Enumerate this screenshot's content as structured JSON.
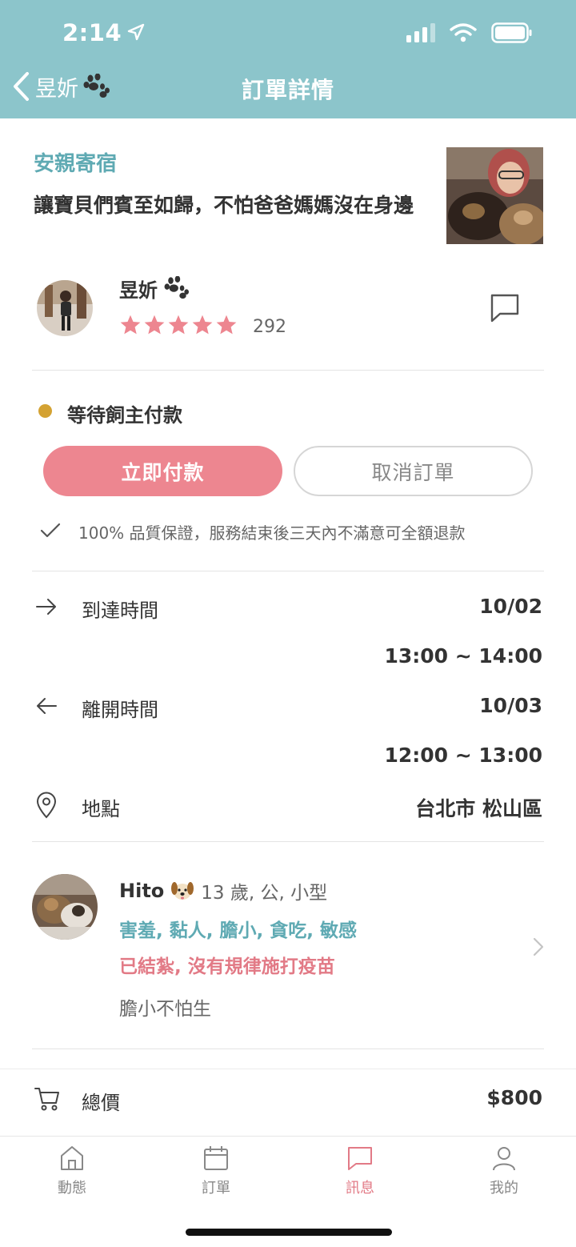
{
  "status_bar": {
    "time": "2:14"
  },
  "nav": {
    "back_label": "昱妡",
    "title": "訂單詳情"
  },
  "service": {
    "category": "安親寄宿",
    "headline": "讓寶貝們賓至如歸，不怕爸爸媽媽沒在身邊"
  },
  "sitter": {
    "name": "昱妡",
    "rating_stars": 5,
    "review_count": "292"
  },
  "order": {
    "status": "等待飼主付款",
    "status_color": "#d4a232",
    "pay_button": "立即付款",
    "cancel_button": "取消訂單",
    "guarantee": "100% 品質保證，服務結束後三天內不滿意可全額退款"
  },
  "schedule": {
    "arrival_label": "到達時間",
    "arrival_date": "10/02",
    "arrival_time": "13:00 ~ 14:00",
    "departure_label": "離開時間",
    "departure_date": "10/03",
    "departure_time": "12:00 ~ 13:00",
    "location_label": "地點",
    "location_value": "台北市 松山區"
  },
  "pet": {
    "name": "Hito",
    "details": "13 歲, 公, 小型",
    "traits": "害羞, 黏人, 膽小, 貪吃, 敏感",
    "health": "已結紮, 沒有規律施打疫苗",
    "note": "膽小不怕生"
  },
  "total": {
    "label": "總價",
    "value": "$800"
  },
  "tabs": [
    {
      "label": "動態",
      "icon": "home-icon"
    },
    {
      "label": "訂單",
      "icon": "calendar-icon"
    },
    {
      "label": "訊息",
      "icon": "message-icon",
      "active": true
    },
    {
      "label": "我的",
      "icon": "profile-icon"
    }
  ],
  "colors": {
    "header": "#8cc5cb",
    "accent_pink": "#ed8690",
    "teal_text": "#5faab3"
  }
}
